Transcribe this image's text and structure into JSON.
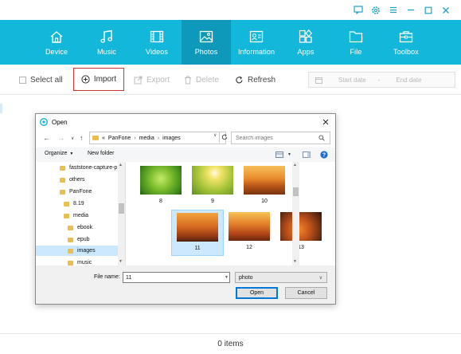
{
  "nav": {
    "items": [
      {
        "label": "Device",
        "icon": "home-icon",
        "active": false
      },
      {
        "label": "Music",
        "icon": "music-icon",
        "active": false
      },
      {
        "label": "Videos",
        "icon": "film-icon",
        "active": false
      },
      {
        "label": "Photos",
        "icon": "photo-icon",
        "active": true
      },
      {
        "label": "Information",
        "icon": "contact-card-icon",
        "active": false
      },
      {
        "label": "Apps",
        "icon": "apps-icon",
        "active": false
      },
      {
        "label": "File",
        "icon": "folder-icon",
        "active": false
      },
      {
        "label": "Toolbox",
        "icon": "toolbox-icon",
        "active": false
      }
    ]
  },
  "colors": {
    "nav_bg": "#12b7d9",
    "nav_active": "#0e99bb",
    "import_border": "#d23232",
    "selection": "#cce8ff"
  },
  "toolbar": {
    "select_all": "Select all",
    "import": "Import",
    "export": "Export",
    "delete": "Delete",
    "refresh": "Refresh",
    "start_date_placeholder": "Start date",
    "date_separator": "-",
    "end_date_placeholder": "End date"
  },
  "footer": {
    "count": "0 items"
  },
  "dialog": {
    "title": "Open",
    "breadcrumb": [
      "«",
      "PanFone",
      "media",
      "images"
    ],
    "search_placeholder": "Search images",
    "organize": "Organize",
    "new_folder": "New folder",
    "tree": [
      {
        "label": "faststone-capture-p",
        "selected": false
      },
      {
        "label": "others",
        "selected": false
      },
      {
        "label": "PanFone",
        "selected": false
      },
      {
        "label": "8.19",
        "selected": false
      },
      {
        "label": "media",
        "selected": false
      },
      {
        "label": "ebook",
        "selected": false
      },
      {
        "label": "epub",
        "selected": false
      },
      {
        "label": "images",
        "selected": true
      },
      {
        "label": "music",
        "selected": false
      }
    ],
    "files": [
      {
        "label": "8",
        "selected": false
      },
      {
        "label": "9",
        "selected": false
      },
      {
        "label": "10",
        "selected": false
      },
      {
        "label": "11",
        "selected": true
      },
      {
        "label": "12",
        "selected": false
      },
      {
        "label": "13",
        "selected": false
      }
    ],
    "file_name_label": "File name:",
    "file_name_value": "11",
    "file_type": "photo",
    "open_button": "Open",
    "cancel_button": "Cancel"
  }
}
